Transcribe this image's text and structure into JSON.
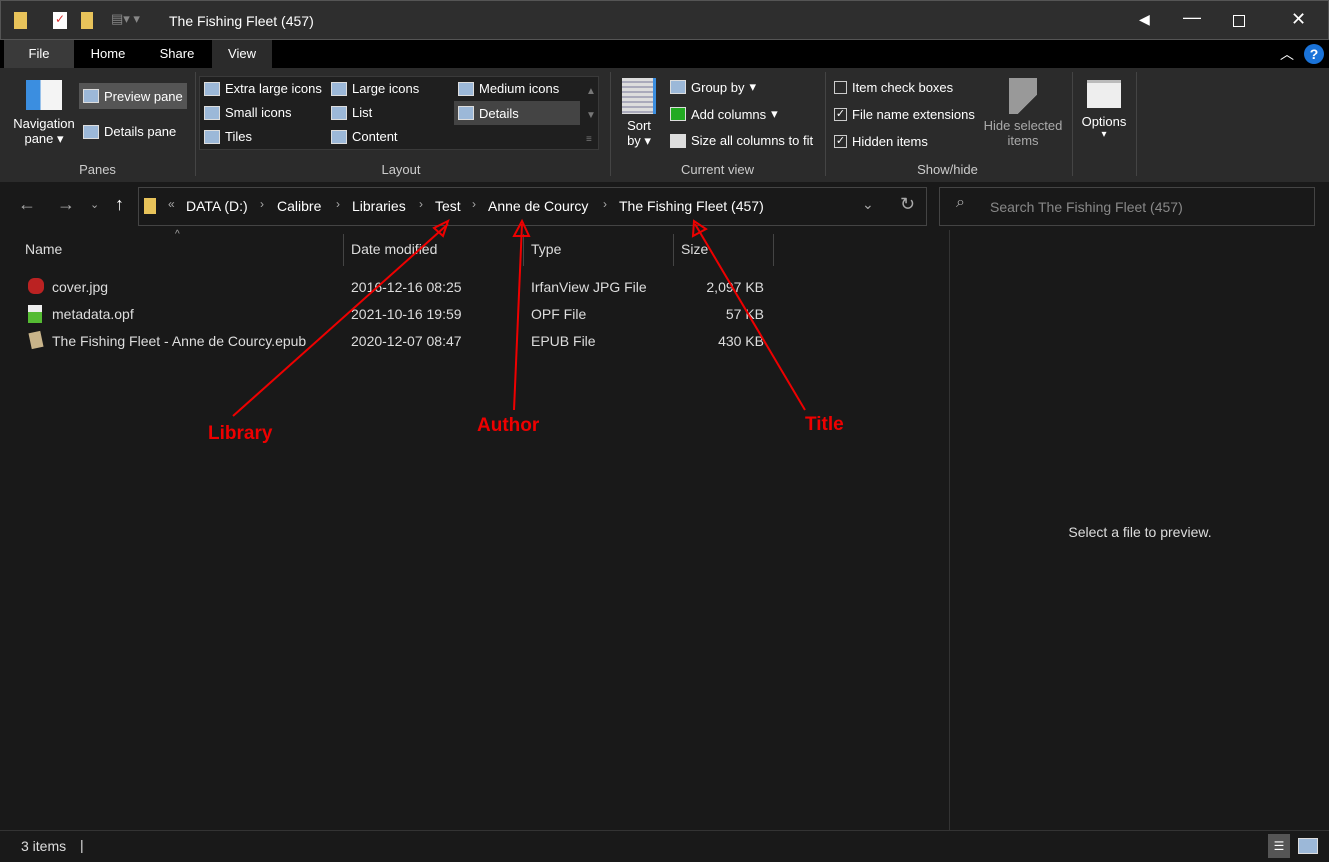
{
  "window": {
    "title": "The Fishing Fleet (457)"
  },
  "tabs": [
    "File",
    "Home",
    "Share",
    "View"
  ],
  "ribbon": {
    "panes": {
      "label": "Panes",
      "navigation_pane": "Navigation",
      "navigation_pane2": "pane",
      "preview_pane": "Preview pane",
      "details_pane": "Details pane"
    },
    "layout": {
      "label": "Layout",
      "items": [
        "Extra large icons",
        "Large icons",
        "Medium icons",
        "Small icons",
        "List",
        "Details",
        "Tiles",
        "Content"
      ]
    },
    "current_view": {
      "label": "Current view",
      "sort": "Sort",
      "sort2": "by",
      "group_by": "Group by",
      "add_columns": "Add columns",
      "size_all": "Size all columns to fit"
    },
    "show_hide": {
      "label": "Show/hide",
      "item_check_boxes": "Item check boxes",
      "file_name_extensions": "File name extensions",
      "hidden_items": "Hidden items",
      "hide_selected": "Hide selected",
      "hide_selected2": "items"
    },
    "options": "Options"
  },
  "address": {
    "crumbs": [
      "DATA (D:)",
      "Calibre",
      "Libraries",
      "Test",
      "Anne de Courcy",
      "The Fishing Fleet (457)"
    ],
    "search_placeholder": "Search The Fishing Fleet (457)"
  },
  "columns": [
    "Name",
    "Date modified",
    "Type",
    "Size"
  ],
  "files": [
    {
      "name": "cover.jpg",
      "date": "2016-12-16 08:25",
      "type": "IrfanView JPG File",
      "size": "2,097 KB"
    },
    {
      "name": "metadata.opf",
      "date": "2021-10-16 19:59",
      "type": "OPF File",
      "size": "57 KB"
    },
    {
      "name": "The Fishing Fleet - Anne de Courcy.epub",
      "date": "2020-12-07 08:47",
      "type": "EPUB File",
      "size": "430 KB"
    }
  ],
  "preview": {
    "message": "Select a file to preview."
  },
  "annotations": {
    "library": "Library",
    "author": "Author",
    "title": "Title"
  },
  "status": {
    "count": "3 items"
  }
}
